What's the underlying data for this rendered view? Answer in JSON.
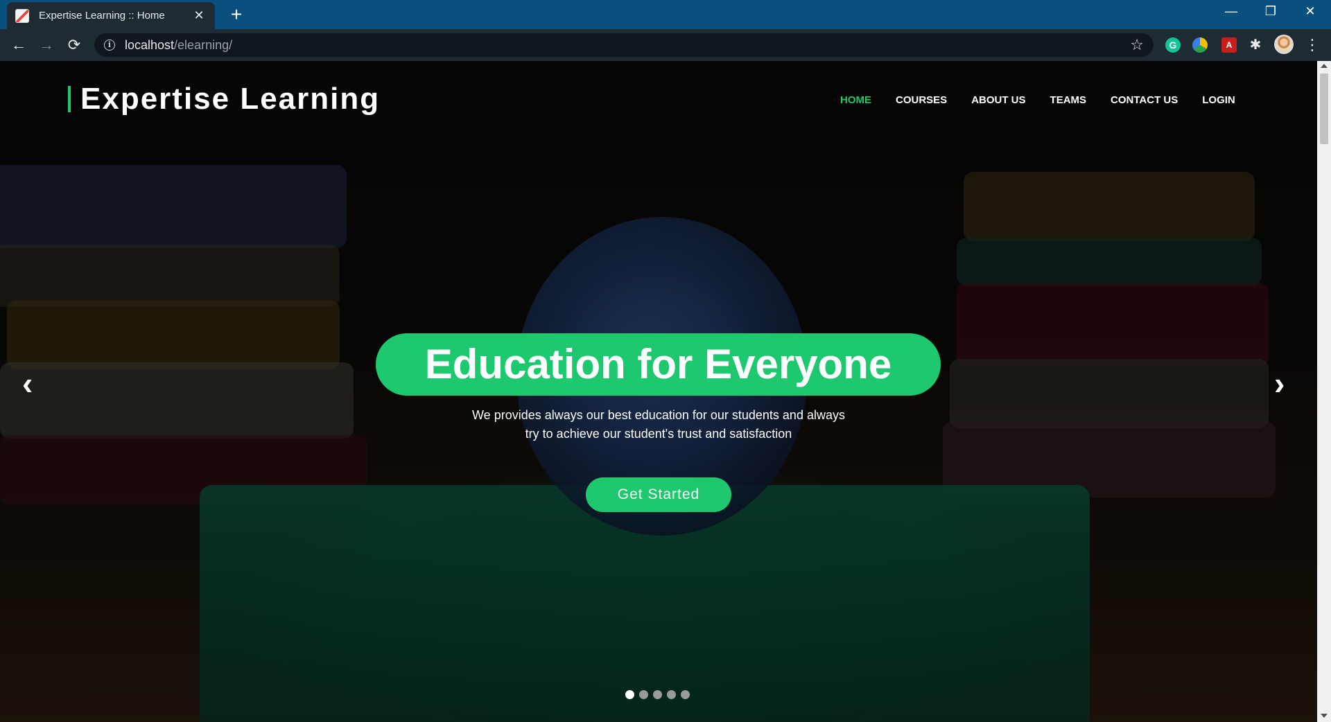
{
  "browser": {
    "tab_title": "Expertise Learning :: Home",
    "tab_close": "✕",
    "new_tab": "+",
    "minimize": "—",
    "restore": "❐",
    "close": "✕",
    "back": "←",
    "forward": "→",
    "reload": "⟳",
    "url_host": "localhost",
    "url_path": "/elearning/",
    "bookmark_star": "☆",
    "extensions": {
      "grammarly": "G",
      "pdf": "A",
      "puzzle": "✱"
    },
    "menu": "⋮"
  },
  "header": {
    "brand": "Expertise Learning",
    "nav": [
      "HOME",
      "COURSES",
      "ABOUT US",
      "TEAMS",
      "CONTACT US",
      "LOGIN"
    ],
    "active_nav": "HOME"
  },
  "hero": {
    "title": "Education for Everyone",
    "subtitle_line1": "We provides always our best education for our students and always",
    "subtitle_line2": "try to achieve our student's trust and satisfaction",
    "cta": "Get Started",
    "prev_arrow": "‹",
    "next_arrow": "›",
    "slide_count": 5,
    "active_slide": 1
  },
  "colors": {
    "accent": "#1ec86e",
    "titlebar": "#0b5180",
    "toolbar": "#1f2b33"
  }
}
